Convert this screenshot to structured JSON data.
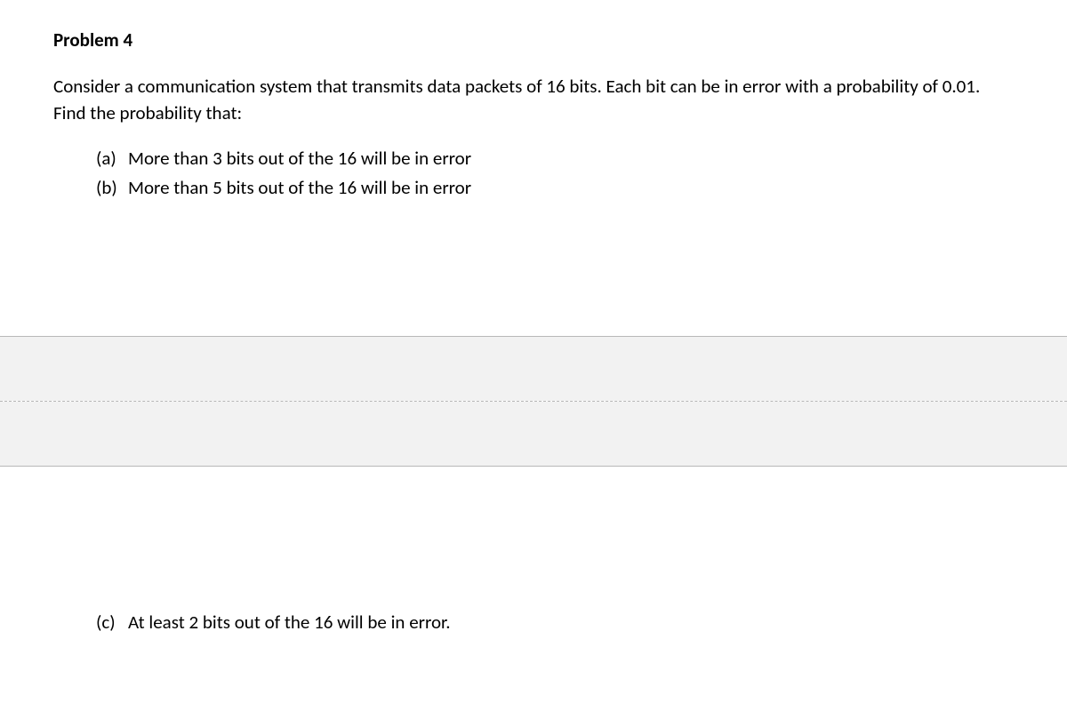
{
  "problem": {
    "title": "Problem 4",
    "statement": "Consider a communication system that transmits data packets of 16 bits. Each bit can be in error with a probability of 0.01. Find the probability that:",
    "parts": [
      {
        "label": "(a)",
        "text": "More than 3 bits out of the 16 will be in error"
      },
      {
        "label": "(b)",
        "text": "More than 5 bits out of the 16 will be in error"
      },
      {
        "label": "(c)",
        "text": "At least 2 bits out of the 16 will be in error."
      }
    ]
  }
}
